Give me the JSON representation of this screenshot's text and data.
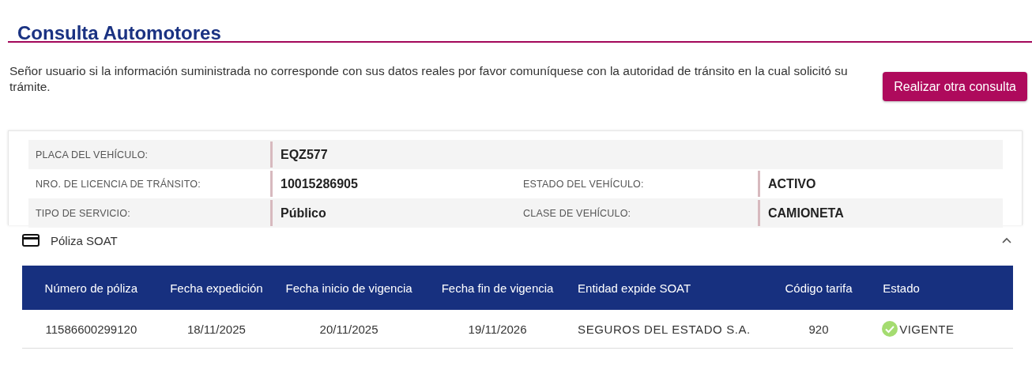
{
  "title": "Consulta Automotores",
  "notice": "Señor usuario si la información suministrada no corresponde con sus datos reales por favor comuníquese con la autoridad de tránsito en la cual solicitó su trámite.",
  "new_query_button": "Realizar otra consulta",
  "vehicle_fields": [
    [
      {
        "label": "PLACA DEL VEHÍCULO:",
        "value": "EQZ577"
      }
    ],
    [
      {
        "label": "NRO. DE LICENCIA DE TRÁNSITO:",
        "value": "10015286905"
      },
      {
        "label": "ESTADO DEL VEHÍCULO:",
        "value": "ACTIVO"
      }
    ],
    [
      {
        "label": "TIPO DE SERVICIO:",
        "value": "Público"
      },
      {
        "label": "CLASE DE VEHÍCULO:",
        "value": "CAMIONETA"
      }
    ]
  ],
  "soat": {
    "title": "Póliza SOAT",
    "expanded": true,
    "table": {
      "columns": [
        "Número de póliza",
        "Fecha expedición",
        "Fecha inicio de vigencia",
        "Fecha fin de vigencia",
        "Entidad expide SOAT",
        "Código tarifa",
        "Estado"
      ],
      "rows": [
        {
          "cells": [
            "11586600299120",
            "18/11/2025",
            "20/11/2025",
            "19/11/2026",
            "SEGUROS DEL ESTADO S.A.",
            "920",
            "VIGENTE"
          ],
          "valid": true
        }
      ]
    }
  }
}
